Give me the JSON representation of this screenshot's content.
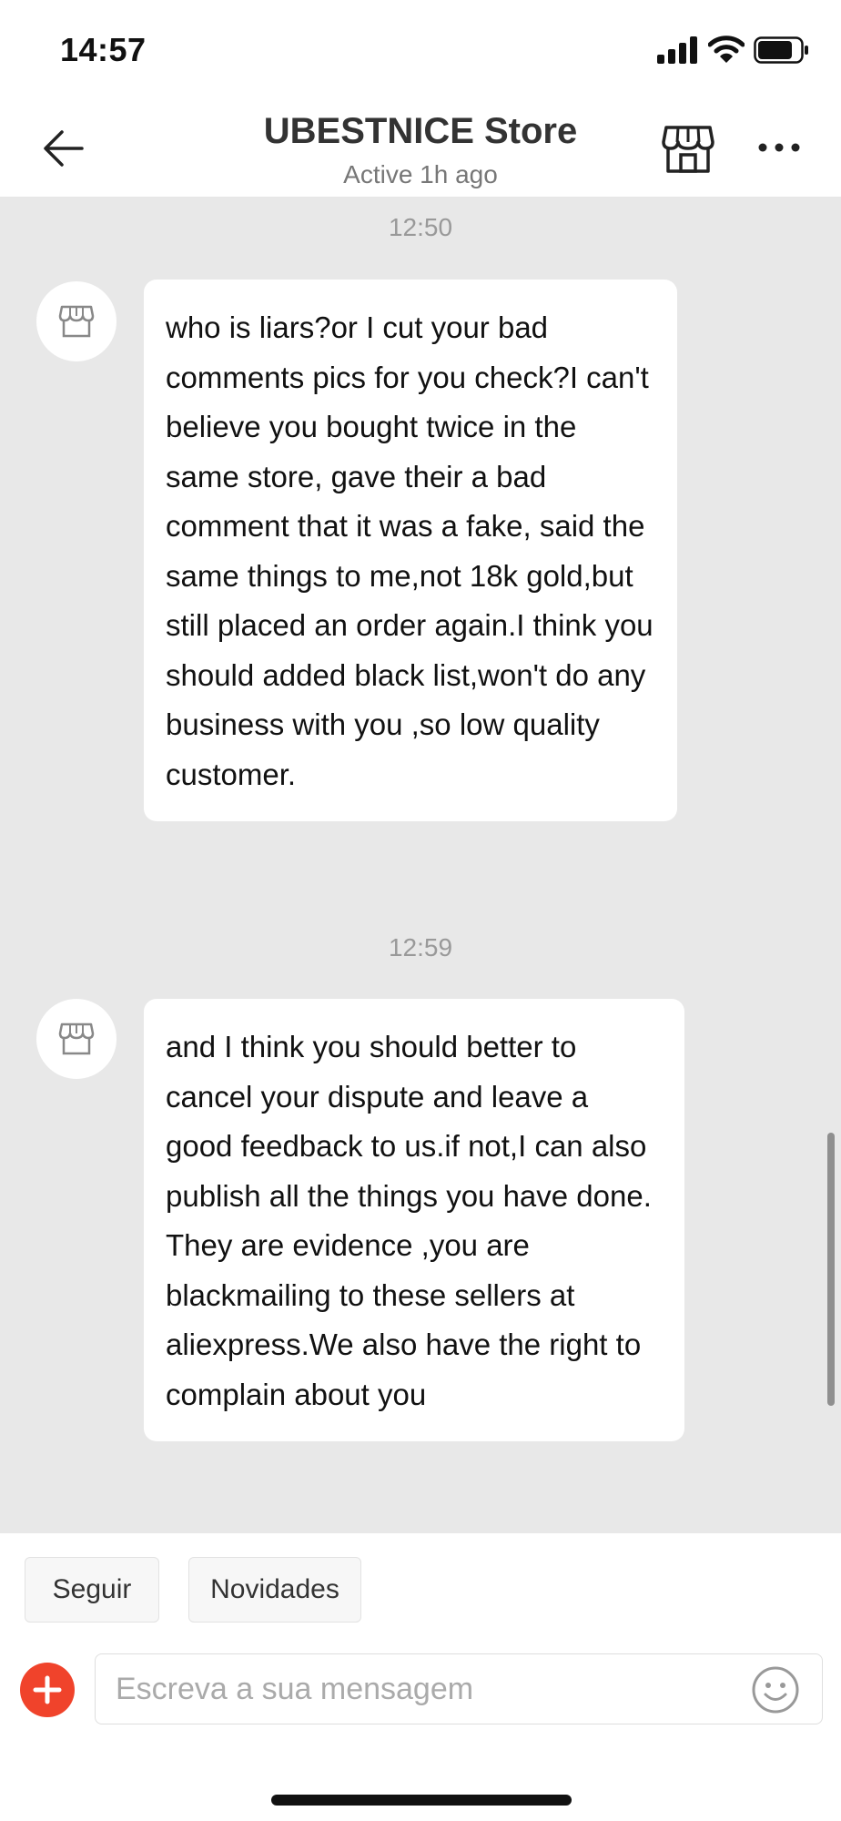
{
  "status_bar": {
    "time": "14:57"
  },
  "header": {
    "title": "UBESTNICE Store",
    "subtitle": "Active 1h ago",
    "back_icon": "arrow-left-icon",
    "store_icon": "storefront-icon",
    "more_icon": "more-dots-icon"
  },
  "chat": {
    "messages": [
      {
        "timestamp": "12:50",
        "sender": "store",
        "avatar_icon": "storefront-icon",
        "text": "who is liars?or I cut your bad comments pics for you check?I can't believe you bought twice in the same store, gave their a bad comment that it was a fake,  said the same things to me,not 18k gold,but still placed an order again.I think you should added black list,won't do any business with you ,so low quality customer."
      },
      {
        "timestamp": "12:59",
        "sender": "store",
        "avatar_icon": "storefront-icon",
        "text": "and I think you should better to cancel your dispute and leave a good feedback to us.if not,I can also publish all the things you have done. They are evidence ,you are blackmailing to these sellers at aliexpress.We also have the right to complain about you"
      }
    ]
  },
  "quick_actions": [
    {
      "label": "Seguir"
    },
    {
      "label": "Novidades"
    }
  ],
  "input": {
    "placeholder": "Escreva a sua mensagem",
    "value": "",
    "plus_icon": "plus-icon",
    "emoji_icon": "smiley-icon"
  },
  "colors": {
    "accent": "#f0432b",
    "chat_background": "#e8e8e8",
    "bubble_background": "#ffffff",
    "timestamp_text": "#999999"
  }
}
